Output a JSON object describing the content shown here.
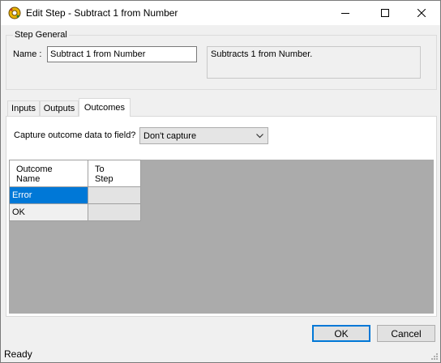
{
  "window": {
    "title": "Edit Step - Subtract 1 from Number",
    "app_icon": "step-gear-icon"
  },
  "step_general": {
    "legend": "Step General",
    "name_label": "Name :",
    "name_value": "Subtract 1 from Number",
    "description": "Subtracts 1 from Number."
  },
  "tabs": [
    {
      "label": "Inputs",
      "active": false
    },
    {
      "label": "Outputs",
      "active": false
    },
    {
      "label": "Outcomes",
      "active": true
    }
  ],
  "outcomes": {
    "capture_label": "Capture outcome data to field?",
    "capture_selected": "Don't capture",
    "columns": [
      "Outcome\nName",
      "To\nStep"
    ],
    "rows": [
      {
        "name": "Error",
        "to_step": "",
        "selected": true
      },
      {
        "name": "OK",
        "to_step": "",
        "selected": false
      }
    ]
  },
  "buttons": {
    "ok": "OK",
    "cancel": "Cancel"
  },
  "status": "Ready",
  "colors": {
    "selection": "#0078d7",
    "grid_background": "#ababab"
  }
}
